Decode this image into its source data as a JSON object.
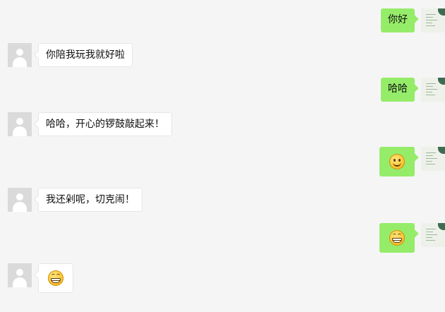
{
  "messages": [
    {
      "side": "right",
      "type": "text",
      "text": "你好"
    },
    {
      "side": "left",
      "type": "text",
      "text": "你陪我玩我就好啦"
    },
    {
      "side": "right",
      "type": "text",
      "text": "哈哈"
    },
    {
      "side": "left",
      "type": "text",
      "text": "哈哈，开心的锣鼓敲起来！"
    },
    {
      "side": "right",
      "type": "emoji",
      "emoji": "smile-emoji"
    },
    {
      "side": "left",
      "type": "text",
      "text": "我还剁呢，切克闹！"
    },
    {
      "side": "right",
      "type": "emoji",
      "emoji": "grin-emoji"
    },
    {
      "side": "left",
      "type": "emoji",
      "emoji": "grin-emoji"
    }
  ],
  "colors": {
    "background": "#f5f5f5",
    "sent_bubble": "#95ec69",
    "received_bubble": "#ffffff",
    "avatar_placeholder": "#dadada"
  }
}
